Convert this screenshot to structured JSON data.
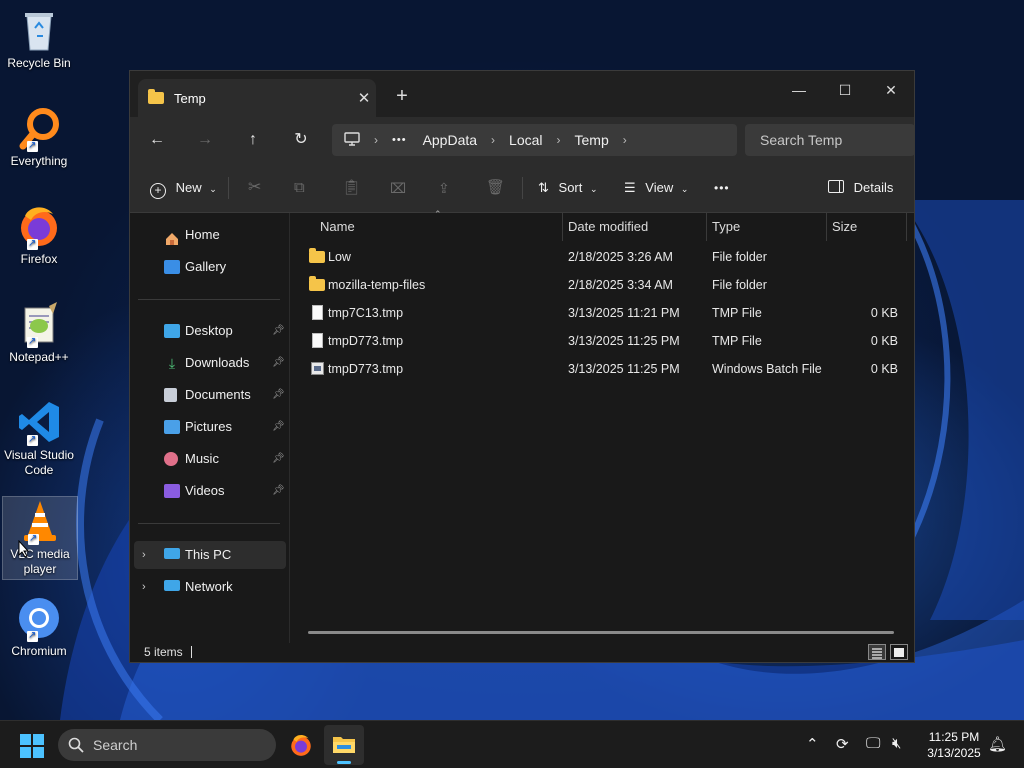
{
  "desktop": {
    "icons": [
      {
        "label": "Recycle Bin"
      },
      {
        "label": "Everything"
      },
      {
        "label": "Firefox"
      },
      {
        "label": "Notepad++"
      },
      {
        "label": "Visual Studio Code"
      },
      {
        "label": "VLC media player"
      },
      {
        "label": "Chromium"
      }
    ]
  },
  "window": {
    "tab_title": "Temp",
    "tab_close": "✕",
    "new_tab": "+",
    "controls": {
      "minimize": "—",
      "maximize": "☐",
      "close": "✕"
    },
    "nav": {
      "back": "←",
      "forward": "→",
      "up": "↑",
      "refresh": "↻"
    },
    "address": {
      "more": "•••",
      "crumbs": [
        "AppData",
        "Local",
        "Temp"
      ]
    },
    "search_placeholder": "Search Temp",
    "toolbar": {
      "new": "New",
      "sort": "Sort",
      "view": "View",
      "more": "•••",
      "details": "Details"
    },
    "sidebar": {
      "home": "Home",
      "gallery": "Gallery",
      "desktop": "Desktop",
      "downloads": "Downloads",
      "documents": "Documents",
      "pictures": "Pictures",
      "music": "Music",
      "videos": "Videos",
      "this_pc": "This PC",
      "network": "Network"
    },
    "columns": {
      "name": "Name",
      "date": "Date modified",
      "type": "Type",
      "size": "Size"
    },
    "files": [
      {
        "name": "Low",
        "date": "2/18/2025 3:26 AM",
        "type": "File folder",
        "size": ""
      },
      {
        "name": "mozilla-temp-files",
        "date": "2/18/2025 3:34 AM",
        "type": "File folder",
        "size": ""
      },
      {
        "name": "tmp7C13.tmp",
        "date": "3/13/2025 11:21 PM",
        "type": "TMP File",
        "size": "0 KB"
      },
      {
        "name": "tmpD773.tmp",
        "date": "3/13/2025 11:25 PM",
        "type": "TMP File",
        "size": "0 KB"
      },
      {
        "name": "tmpD773.tmp",
        "date": "3/13/2025 11:25 PM",
        "type": "Windows Batch File",
        "size": "0 KB"
      }
    ],
    "status": "5 items"
  },
  "taskbar": {
    "search": "Search",
    "time": "11:25 PM",
    "date": "3/13/2025"
  },
  "colors": {
    "accent": "#0078d4",
    "folder": "#f5c449"
  }
}
